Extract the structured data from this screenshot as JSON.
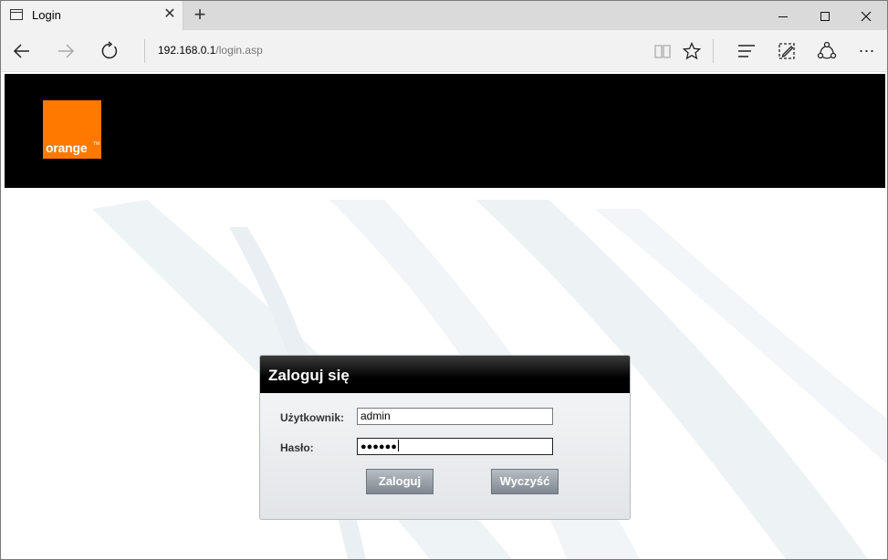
{
  "browser": {
    "tab_title": "Login",
    "tab_close": "✕",
    "new_tab": "+",
    "address_host": "192.168.0.1",
    "address_path": "/login.asp",
    "more": "⋯"
  },
  "page": {
    "logo_text": "orange",
    "logo_tm": "TM",
    "brand_color": "#ff7900"
  },
  "login": {
    "title": "Zaloguj się",
    "user_label": "Użytkownik:",
    "user_value": "admin",
    "pass_label": "Hasło:",
    "pass_masked": "●●●●●●",
    "login_button": "Zaloguj",
    "clear_button": "Wyczyść"
  }
}
